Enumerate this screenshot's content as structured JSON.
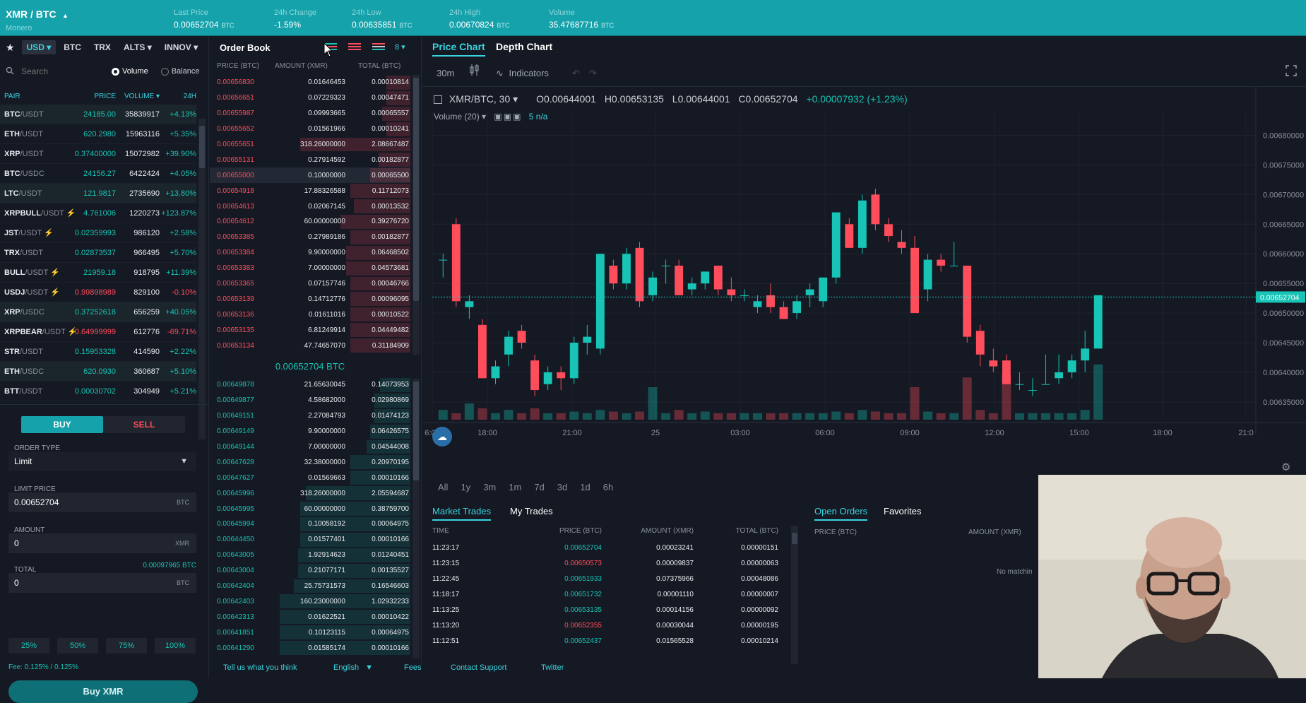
{
  "topbar": {
    "pair": "XMR / BTC",
    "name": "Monero",
    "stats": [
      {
        "label": "Last Price",
        "value": "0.00652704",
        "unit": "BTC"
      },
      {
        "label": "24h Change",
        "value": "-1.59%",
        "unit": ""
      },
      {
        "label": "24h Low",
        "value": "0.00635851",
        "unit": "BTC"
      },
      {
        "label": "24h High",
        "value": "0.00670824",
        "unit": "BTC"
      },
      {
        "label": "Volume",
        "value": "35.47687716",
        "unit": "BTC"
      }
    ]
  },
  "markets": {
    "tabs": [
      "USD ▾",
      "BTC",
      "TRX",
      "ALTS ▾",
      "INNOV ▾"
    ],
    "search_placeholder": "Search",
    "radio_volume": "Volume",
    "radio_balance": "Balance",
    "headers": {
      "pair": "PAIR",
      "price": "PRICE",
      "volume": "VOLUME ▾",
      "change": "24H"
    },
    "rows": [
      {
        "base": "BTC",
        "quote": "/USDT",
        "price": "24185.00",
        "volume": "35839917",
        "change": "+4.13%",
        "down": false,
        "bolt": false
      },
      {
        "base": "ETH",
        "quote": "/USDT",
        "price": "620.2980",
        "volume": "15963116",
        "change": "+5.35%",
        "down": false,
        "bolt": false
      },
      {
        "base": "XRP",
        "quote": "/USDT",
        "price": "0.37400000",
        "volume": "15072982",
        "change": "+39.90%",
        "down": false,
        "bolt": false
      },
      {
        "base": "BTC",
        "quote": "/USDC",
        "price": "24156.27",
        "volume": "6422424",
        "change": "+4.05%",
        "down": false,
        "bolt": false
      },
      {
        "base": "LTC",
        "quote": "/USDT",
        "price": "121.9817",
        "volume": "2735690",
        "change": "+13.80%",
        "down": false,
        "bolt": false
      },
      {
        "base": "XRPBULL",
        "quote": "/USDT",
        "price": "4.761006",
        "volume": "1220273",
        "change": "+123.87%",
        "down": false,
        "bolt": true
      },
      {
        "base": "JST",
        "quote": "/USDT",
        "price": "0.02359993",
        "volume": "986120",
        "change": "+2.58%",
        "down": false,
        "bolt": true
      },
      {
        "base": "TRX",
        "quote": "/USDT",
        "price": "0.02873537",
        "volume": "966495",
        "change": "+5.70%",
        "down": false,
        "bolt": false
      },
      {
        "base": "BULL",
        "quote": "/USDT",
        "price": "21959.18",
        "volume": "918795",
        "change": "+11.39%",
        "down": false,
        "bolt": true
      },
      {
        "base": "USDJ",
        "quote": "/USDT",
        "price": "0.99898989",
        "volume": "829100",
        "change": "-0.10%",
        "down": true,
        "bolt": true
      },
      {
        "base": "XRP",
        "quote": "/USDC",
        "price": "0.37252618",
        "volume": "656259",
        "change": "+40.05%",
        "down": false,
        "bolt": false
      },
      {
        "base": "XRPBEAR",
        "quote": "/USDT",
        "price": "0.64999999",
        "volume": "612776",
        "change": "-69.71%",
        "down": true,
        "bolt": true
      },
      {
        "base": "STR",
        "quote": "/USDT",
        "price": "0.15953328",
        "volume": "414590",
        "change": "+2.22%",
        "down": false,
        "bolt": false
      },
      {
        "base": "ETH",
        "quote": "/USDC",
        "price": "620.0930",
        "volume": "360687",
        "change": "+5.10%",
        "down": false,
        "bolt": false
      },
      {
        "base": "BTT",
        "quote": "/USDT",
        "price": "0.00030702",
        "volume": "304949",
        "change": "+5.21%",
        "down": false,
        "bolt": false
      }
    ]
  },
  "form": {
    "buy": "BUY",
    "sell": "SELL",
    "order_type_label": "ORDER TYPE",
    "order_type_value": "Limit",
    "limit_label": "LIMIT PRICE",
    "limit_value": "0.00652704",
    "limit_unit": "BTC",
    "amount_label": "AMOUNT",
    "amount_value": "0",
    "amount_unit": "XMR",
    "total_label": "TOTAL",
    "total_hint": "0.00097965 BTC",
    "total_value": "0",
    "total_unit": "BTC",
    "pcts": [
      "25%",
      "50%",
      "75%",
      "100%"
    ],
    "fee": "Fee: 0.125% / 0.125%",
    "submit": "Buy XMR"
  },
  "orderbook": {
    "title": "Order Book",
    "group": "8 ▾",
    "headers": [
      "PRICE (BTC)",
      "AMOUNT (XMR)",
      "TOTAL (BTC)"
    ],
    "asks": [
      [
        "0.00656830",
        "0.01646453",
        "0.00010814",
        0.12
      ],
      [
        "0.00656651",
        "0.07229323",
        "0.00047471",
        0.12
      ],
      [
        "0.00655987",
        "0.09993665",
        "0.00065557",
        0.14
      ],
      [
        "0.00655652",
        "0.01561966",
        "0.00010241",
        0.12
      ],
      [
        "0.00655651",
        "318.26000000",
        "2.08667487",
        0.55
      ],
      [
        "0.00655131",
        "0.27914592",
        "0.00182877",
        0.16
      ],
      [
        "0.00655000",
        "0.10000000",
        "0.00065500",
        0.2
      ],
      [
        "0.00654918",
        "17.88326588",
        "0.11712073",
        0.3
      ],
      [
        "0.00654613",
        "0.02067145",
        "0.00013532",
        0.28
      ],
      [
        "0.00654612",
        "60.00000000",
        "0.39276720",
        0.35
      ],
      [
        "0.00653385",
        "0.27989186",
        "0.00182877",
        0.3
      ],
      [
        "0.00653384",
        "9.90000000",
        "0.06468502",
        0.32
      ],
      [
        "0.00653383",
        "7.00000000",
        "0.04573681",
        0.32
      ],
      [
        "0.00653365",
        "0.07157746",
        "0.00046766",
        0.3
      ],
      [
        "0.00653139",
        "0.14712776",
        "0.00096095",
        0.3
      ],
      [
        "0.00653136",
        "0.01611016",
        "0.00010522",
        0.3
      ],
      [
        "0.00653135",
        "6.81249914",
        "0.04449482",
        0.3
      ],
      [
        "0.00653134",
        "47.74657070",
        "0.31184909",
        0.3
      ]
    ],
    "mid": "0.00652704 BTC",
    "bids": [
      [
        "0.00649878",
        "21.65630045",
        "0.14073953",
        0.15
      ],
      [
        "0.00649877",
        "4.58682000",
        "0.02980869",
        0.18
      ],
      [
        "0.00649151",
        "2.27084793",
        "0.01474123",
        0.18
      ],
      [
        "0.00649149",
        "9.90000000",
        "0.06426575",
        0.2
      ],
      [
        "0.00649144",
        "7.00000000",
        "0.04544008",
        0.22
      ],
      [
        "0.00647628",
        "32.38000000",
        "0.20970195",
        0.3
      ],
      [
        "0.00647627",
        "0.01569663",
        "0.00010166",
        0.3
      ],
      [
        "0.00645996",
        "318.26000000",
        "2.05594687",
        0.52
      ],
      [
        "0.00645995",
        "60.00000000",
        "0.38759700",
        0.55
      ],
      [
        "0.00645994",
        "0.10058192",
        "0.00064975",
        0.55
      ],
      [
        "0.00644450",
        "0.01577401",
        "0.00010166",
        0.55
      ],
      [
        "0.00643005",
        "1.92914623",
        "0.01240451",
        0.56
      ],
      [
        "0.00643004",
        "0.21077171",
        "0.00135527",
        0.56
      ],
      [
        "0.00642404",
        "25.75731573",
        "0.16546603",
        0.58
      ],
      [
        "0.00642403",
        "160.23000000",
        "1.02932233",
        0.65
      ],
      [
        "0.00642313",
        "0.01622521",
        "0.00010422",
        0.65
      ],
      [
        "0.00641851",
        "0.10123115",
        "0.00064975",
        0.65
      ],
      [
        "0.00641290",
        "0.01585174",
        "0.00010166",
        0.65
      ]
    ]
  },
  "chart": {
    "tabs": [
      "Price Chart",
      "Depth Chart"
    ],
    "interval": "30m",
    "indicators": "Indicators",
    "symbol": "XMR/BTC, 30 ▾",
    "ohlc": {
      "o": "O0.00644001",
      "h": "H0.00653135",
      "l": "L0.00644001",
      "c": "C0.00652704",
      "chg": "+0.00007932 (+1.23%)"
    },
    "volume_label": "Volume (20) ▾",
    "volume_value": "5  n/a",
    "last_price_tag": "0.00652704",
    "ranges": [
      "All",
      "1y",
      "3m",
      "1m",
      "7d",
      "3d",
      "1d",
      "6h"
    ]
  },
  "chart_data": {
    "type": "candlestick",
    "ylim": [
      0.00632,
      0.00684
    ],
    "y_ticks": [
      "0.00680000",
      "0.00675000",
      "0.00670000",
      "0.00665000",
      "0.00660000",
      "0.00655000",
      "0.00650000",
      "0.00645000",
      "0.00640000",
      "0.00635000"
    ],
    "x_ticks": [
      "6:00",
      "18:00",
      "21:00",
      "25",
      "03:00",
      "06:00",
      "09:00",
      "12:00",
      "15:00",
      "18:00",
      "21:0"
    ],
    "candles": [
      [
        0.00659,
        0.0066,
        0.00656,
        0.00659
      ],
      [
        0.00665,
        0.00666,
        0.00651,
        0.00652
      ],
      [
        0.00651,
        0.00653,
        0.00649,
        0.00652
      ],
      [
        0.00648,
        0.00649,
        0.00639,
        0.00639
      ],
      [
        0.00639,
        0.00642,
        0.00638,
        0.00641
      ],
      [
        0.00643,
        0.00647,
        0.00641,
        0.00646
      ],
      [
        0.00647,
        0.00648,
        0.00644,
        0.00645
      ],
      [
        0.00642,
        0.00643,
        0.00636,
        0.00637
      ],
      [
        0.00638,
        0.00641,
        0.00637,
        0.0064
      ],
      [
        0.0064,
        0.00641,
        0.00637,
        0.00639
      ],
      [
        0.00639,
        0.00646,
        0.00638,
        0.00645
      ],
      [
        0.00645,
        0.00648,
        0.00643,
        0.00646
      ],
      [
        0.00644,
        0.0066,
        0.00643,
        0.0066
      ],
      [
        0.00658,
        0.00659,
        0.00654,
        0.00655
      ],
      [
        0.00655,
        0.00661,
        0.00654,
        0.0066
      ],
      [
        0.00661,
        0.00662,
        0.00651,
        0.00652
      ],
      [
        0.00653,
        0.00657,
        0.00652,
        0.00656
      ],
      [
        0.00658,
        0.00659,
        0.00655,
        0.00658
      ],
      [
        0.00658,
        0.00659,
        0.00653,
        0.00653
      ],
      [
        0.00654,
        0.00656,
        0.00653,
        0.00655
      ],
      [
        0.00655,
        0.00657,
        0.00654,
        0.00657
      ],
      [
        0.00658,
        0.00658,
        0.00653,
        0.00654
      ],
      [
        0.00654,
        0.00656,
        0.00652,
        0.00653
      ],
      [
        0.00653,
        0.00654,
        0.00652,
        0.00653
      ],
      [
        0.00651,
        0.00653,
        0.0065,
        0.00652
      ],
      [
        0.00653,
        0.00655,
        0.0065,
        0.00651
      ],
      [
        0.00651,
        0.00652,
        0.00649,
        0.00649
      ],
      [
        0.0065,
        0.00653,
        0.00649,
        0.00652
      ],
      [
        0.00653,
        0.00655,
        0.00651,
        0.00654
      ],
      [
        0.00652,
        0.00656,
        0.00651,
        0.00656
      ],
      [
        0.00656,
        0.00667,
        0.00655,
        0.00667
      ],
      [
        0.00665,
        0.00666,
        0.00661,
        0.00661
      ],
      [
        0.00661,
        0.0067,
        0.0066,
        0.00669
      ],
      [
        0.0067,
        0.00671,
        0.00664,
        0.00665
      ],
      [
        0.00665,
        0.00666,
        0.00662,
        0.00663
      ],
      [
        0.00662,
        0.00664,
        0.0066,
        0.00661
      ],
      [
        0.00661,
        0.00663,
        0.0065,
        0.0065
      ],
      [
        0.00654,
        0.0066,
        0.00652,
        0.00659
      ],
      [
        0.00659,
        0.0066,
        0.00657,
        0.00658
      ],
      [
        0.00658,
        0.00662,
        0.00658,
        0.00658
      ],
      [
        0.00658,
        0.00658,
        0.00645,
        0.00646
      ],
      [
        0.00647,
        0.00648,
        0.00641,
        0.00643
      ],
      [
        0.00642,
        0.00644,
        0.0064,
        0.00641
      ],
      [
        0.00642,
        0.00643,
        0.00638,
        0.00638
      ],
      [
        0.00638,
        0.0064,
        0.00637,
        0.00638
      ],
      [
        0.00637,
        0.00639,
        0.00636,
        0.00637
      ],
      [
        0.00638,
        0.00643,
        0.00638,
        0.00638
      ],
      [
        0.00639,
        0.00643,
        0.00638,
        0.0064
      ],
      [
        0.0064,
        0.00643,
        0.00639,
        0.00642
      ],
      [
        0.00642,
        0.00647,
        0.0064,
        0.00644
      ],
      [
        0.00644,
        0.00653,
        0.00644,
        0.00653
      ]
    ],
    "volumes": [
      0.3,
      0.2,
      0.5,
      0.35,
      0.2,
      0.3,
      0.2,
      0.35,
      0.2,
      0.2,
      0.25,
      0.2,
      0.3,
      0.25,
      0.2,
      0.25,
      1.0,
      0.2,
      0.3,
      0.2,
      0.25,
      0.2,
      0.2,
      0.2,
      0.2,
      0.2,
      0.2,
      0.2,
      0.2,
      0.2,
      0.25,
      0.2,
      0.3,
      0.25,
      0.2,
      0.2,
      1.0,
      0.25,
      0.2,
      0.2,
      1.3,
      0.3,
      0.2,
      1.4,
      0.2,
      0.2,
      0.2,
      0.2,
      0.2,
      0.3,
      1.7
    ]
  },
  "trades": {
    "tabs": [
      "Market Trades",
      "My Trades"
    ],
    "headers": [
      "TIME",
      "PRICE (BTC)",
      "AMOUNT (XMR)",
      "TOTAL (BTC)"
    ],
    "rows": [
      [
        "11:23:17",
        "0.00652704",
        "0.00023241",
        "0.00000151",
        false
      ],
      [
        "11:23:15",
        "0.00650573",
        "0.00009837",
        "0.00000063",
        true
      ],
      [
        "11:22:45",
        "0.00651933",
        "0.07375966",
        "0.00048086",
        false
      ],
      [
        "11:18:17",
        "0.00651732",
        "0.00001110",
        "0.00000007",
        false
      ],
      [
        "11:13:25",
        "0.00653135",
        "0.00014156",
        "0.00000092",
        false
      ],
      [
        "11:13:20",
        "0.00652355",
        "0.00030044",
        "0.00000195",
        true
      ],
      [
        "11:12:51",
        "0.00652437",
        "0.01565528",
        "0.00010214",
        false
      ]
    ]
  },
  "open_orders": {
    "tabs": [
      "Open Orders",
      "Favorites"
    ],
    "headers": [
      "PRICE (BTC)",
      "AMOUNT (XMR)"
    ],
    "empty": "No matchin"
  },
  "footer": {
    "links": [
      "Tell us what you think",
      "English",
      "Fees",
      "Contact Support",
      "Twitter"
    ]
  }
}
